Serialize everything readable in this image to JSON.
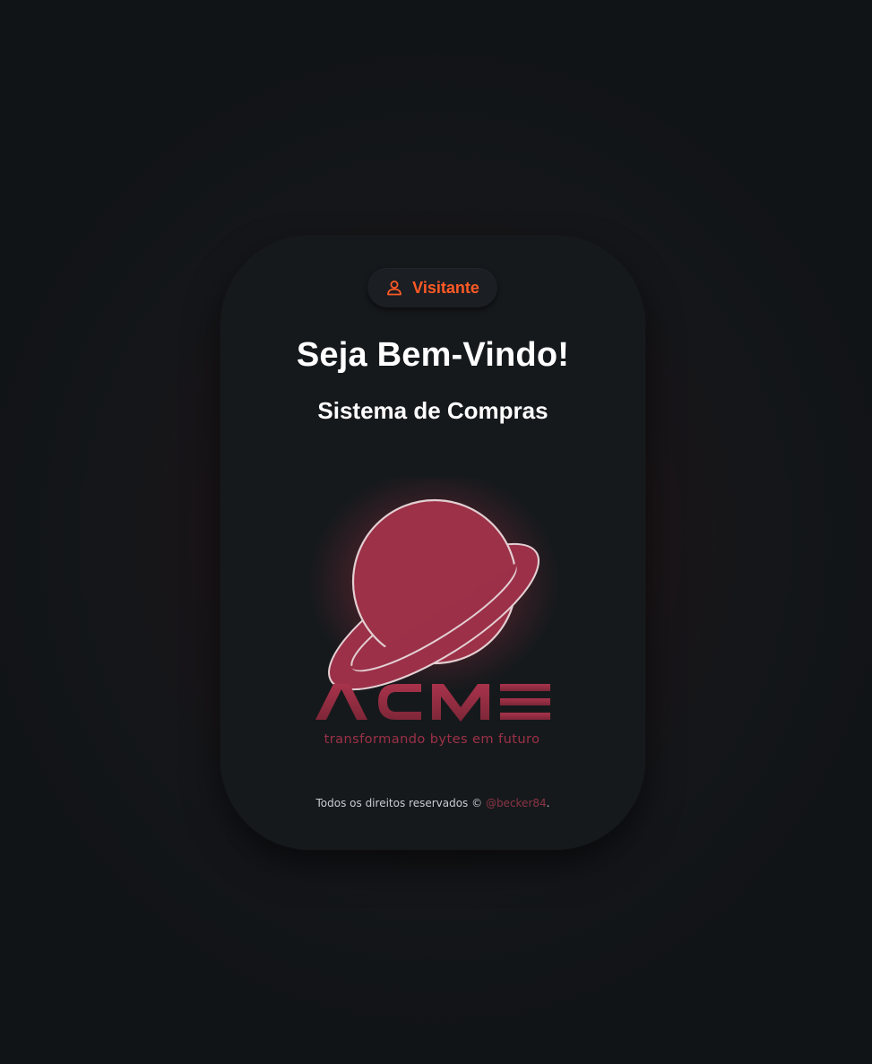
{
  "user": {
    "label": "Visitante",
    "icon": "user-icon"
  },
  "header": {
    "title": "Seja Bem-Vindo!",
    "subtitle": "Sistema de Compras"
  },
  "brand": {
    "name": "ACME",
    "tagline": "transformando bytes em futuro",
    "logo_icon": "planet-icon"
  },
  "footer": {
    "text": "Todos os direitos reservados ©",
    "author_link": "@becker84",
    "trailing": "."
  },
  "colors": {
    "accent": "#ff5a26",
    "brand": "#9c3147",
    "link": "#8a3545",
    "card_bg": "#16191c",
    "page_bg": "#111417"
  }
}
